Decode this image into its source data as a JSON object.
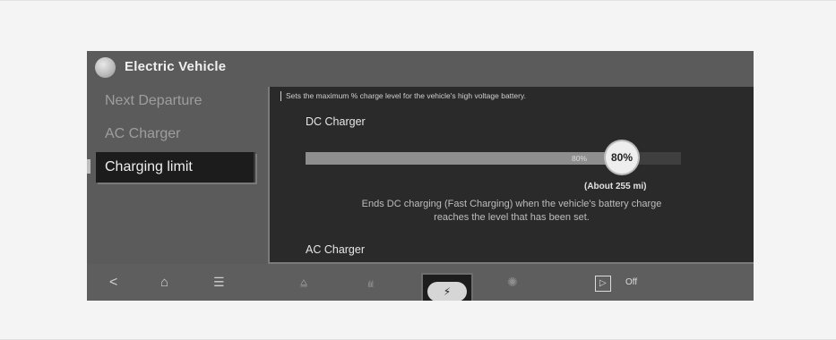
{
  "app": {
    "title": "Electric Vehicle",
    "logo_icon": "ev-globe-icon"
  },
  "sidebar": {
    "items": [
      {
        "label": "Next Departure",
        "selected": false
      },
      {
        "label": "AC Charger",
        "selected": false
      },
      {
        "label": "Charging limit",
        "selected": true
      }
    ]
  },
  "panel": {
    "description": "Sets the maximum % charge level for the vehicle's high voltage battery.",
    "dc": {
      "title": "DC Charger",
      "value_percent": 80,
      "inline_label": "80%",
      "knob_label": "80%",
      "range_label": "(About 255 mi)",
      "help_line1": "Ends DC charging (Fast Charging) when the vehicle's battery charge",
      "help_line2": "reaches the level that has been set."
    },
    "ac": {
      "title": "AC Charger"
    }
  },
  "bottom_bar": {
    "icons": [
      {
        "name": "back-icon",
        "glyph": "<"
      },
      {
        "name": "home-icon",
        "glyph": "⌂"
      },
      {
        "name": "menu-icon",
        "glyph": "☰"
      },
      {
        "name": "eco-icon",
        "glyph": "⩠"
      },
      {
        "name": "energy-chart-icon",
        "glyph": "ılıl"
      },
      {
        "name": "ev-charging-icon",
        "glyph": "⚡"
      },
      {
        "name": "settings-gear-icon",
        "glyph": "✺"
      },
      {
        "name": "media-play-icon",
        "glyph": "▷"
      }
    ],
    "media_status": "Off"
  },
  "colors": {
    "screen_bg": "#5b5b5b",
    "panel_bg": "#2a2a2a",
    "selected_bg": "#1c1c1c",
    "slider_fill": "#8e8e8e",
    "knob": "#eeeeee"
  }
}
